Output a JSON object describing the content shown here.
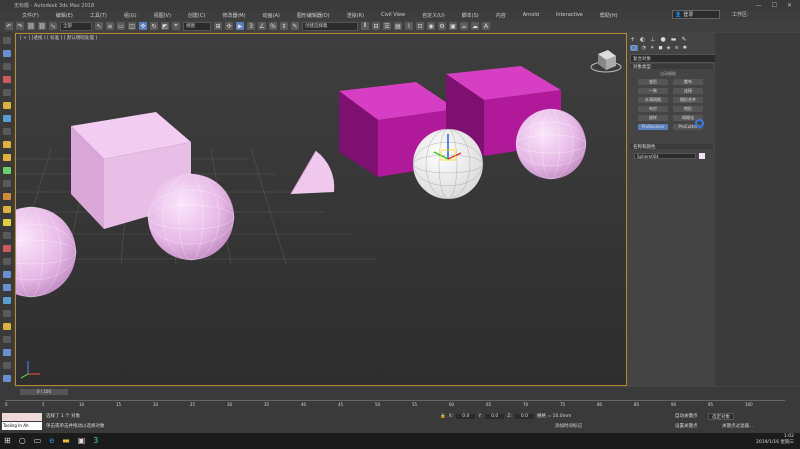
{
  "window": {
    "title": "无标题 - Autodesk 3ds Max 2018"
  },
  "menu": [
    "文件(F)",
    "编辑(E)",
    "工具(T)",
    "组(G)",
    "视图(V)",
    "创建(C)",
    "修改器(M)",
    "动画(A)",
    "图形编辑器(D)",
    "渲染(R)",
    "Civil View",
    "自定义(U)",
    "脚本(S)",
    "内容",
    "Arnold",
    "Interactive",
    "帮助(H)"
  ],
  "user": {
    "login_label": "登录",
    "workspace_label": "工作区:"
  },
  "toolbar": {
    "filter_value": "全部",
    "view_value": "视图",
    "selection_set_value": "创建选择集"
  },
  "viewport": {
    "label": "[ + ] [透视 ] [ 标准 ] [ 默认明暗处理 ]"
  },
  "command_panel": {
    "category_value": "复合对象",
    "rollout_object_type": "对象类型",
    "autogrid_label": "自动栅格",
    "buttons": [
      "变形",
      "散布",
      "一致",
      "连接",
      "水滴网格",
      "图形合并",
      "布尔",
      "地形",
      "放样",
      "网格化",
      "ProBoolean",
      "ProCutter"
    ],
    "rollout_name_color": "名称和颜色",
    "object_name": "Sphere004"
  },
  "timeline": {
    "frame": "0 / 100",
    "ticks": [
      "0",
      "5",
      "10",
      "15",
      "20",
      "25",
      "30",
      "35",
      "40",
      "45",
      "50",
      "55",
      "60",
      "65",
      "70",
      "75",
      "80",
      "85",
      "90",
      "95",
      "100"
    ]
  },
  "status": {
    "selected_text": "选择了 1 个 对象",
    "prompt_text": "单击或单击并拖动以选择对象",
    "script_field": "Tooling In Ah",
    "x_label": "X:",
    "x_value": "0.0",
    "y_label": "Y:",
    "y_value": "0.0",
    "z_label": "Z:",
    "z_value": "0.0",
    "grid_label": "栅格 = 10.0mm",
    "add_time_tag": "添加时间标记",
    "auto_key_label": "自动关键点",
    "set_key_label": "设置关键点",
    "selected_object_value": "选定对象",
    "key_filter_label": "关键点过滤器..."
  },
  "clock": {
    "time": "1:02",
    "date": "2019/1/16 星期三"
  },
  "colors": {
    "sphere": "#e6b8e6",
    "box_light": "#dfaede",
    "box_magenta": "#b0199a",
    "viewport_border": "#b88a2c"
  }
}
